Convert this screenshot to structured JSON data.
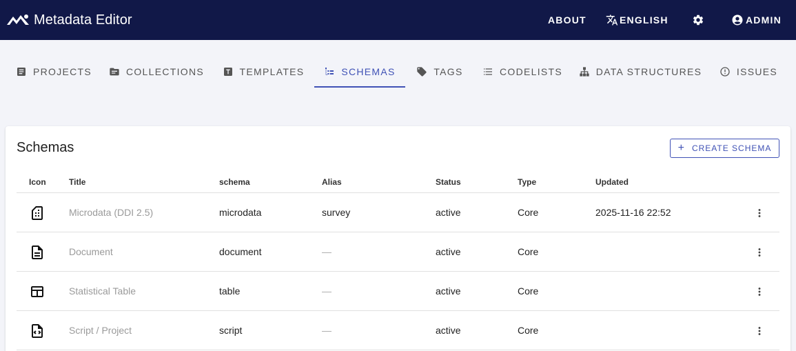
{
  "app": {
    "title": "Metadata Editor"
  },
  "topnav": {
    "about": "ABOUT",
    "language": "ENGLISH",
    "user": "ADMIN"
  },
  "tabs": [
    {
      "label": "PROJECTS",
      "icon": "article-icon"
    },
    {
      "label": "COLLECTIONS",
      "icon": "folder-icon"
    },
    {
      "label": "TEMPLATES",
      "icon": "text-box-icon"
    },
    {
      "label": "SCHEMAS",
      "icon": "schema-icon",
      "active": true
    },
    {
      "label": "TAGS",
      "icon": "tag-icon"
    },
    {
      "label": "CODELISTS",
      "icon": "list-icon"
    },
    {
      "label": "DATA STRUCTURES",
      "icon": "sitemap-icon"
    },
    {
      "label": "ISSUES",
      "icon": "alert-circle-icon"
    }
  ],
  "card": {
    "title": "Schemas",
    "create_button": "CREATE SCHEMA"
  },
  "table": {
    "headers": [
      "Icon",
      "Title",
      "schema",
      "Alias",
      "Status",
      "Type",
      "Updated"
    ],
    "rows": [
      {
        "icon": "sd-card-icon",
        "title": "Microdata (DDI 2.5)",
        "schema": "microdata",
        "alias": "survey",
        "status": "active",
        "type": "Core",
        "updated": "2025-11-16 22:52"
      },
      {
        "icon": "document-icon",
        "title": "Document",
        "schema": "document",
        "alias": "—",
        "status": "active",
        "type": "Core",
        "updated": ""
      },
      {
        "icon": "table-icon",
        "title": "Statistical Table",
        "schema": "table",
        "alias": "—",
        "status": "active",
        "type": "Core",
        "updated": ""
      },
      {
        "icon": "code-file-icon",
        "title": "Script / Project",
        "schema": "script",
        "alias": "—",
        "status": "active",
        "type": "Core",
        "updated": ""
      }
    ]
  },
  "colors": {
    "topbar": "#111848",
    "accent": "#3f51b5",
    "background": "#f3f4f9"
  }
}
